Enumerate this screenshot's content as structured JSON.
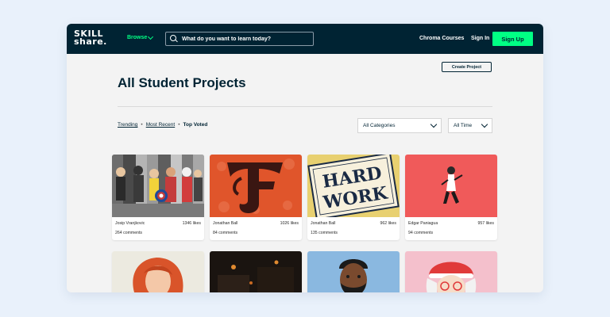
{
  "header": {
    "logo_line1": "SKILL",
    "logo_line2": "share.",
    "browse_label": "Browse",
    "search_placeholder": "What do you want to learn today?",
    "chroma_label": "Chroma Courses",
    "signin_label": "Sign In",
    "signup_label": "Sign Up"
  },
  "main": {
    "create_label": "Create Project",
    "title": "All Student Projects",
    "filters": {
      "trending": "Trending",
      "most_recent": "Most Recent",
      "top_voted": "Top Voted",
      "separator": "•"
    },
    "category_select": "All Categories",
    "time_select": "All Time"
  },
  "projects": [
    {
      "author": "Josip Vranjkovic",
      "likes": "1346 likes",
      "comments": "264 comments"
    },
    {
      "author": "Jonathan Ball",
      "likes": "1026 likes",
      "comments": "84 comments"
    },
    {
      "author": "Jonathan Ball",
      "likes": "962 likes",
      "comments": "135 comments"
    },
    {
      "author": "Edgar Paniagua",
      "likes": "957 likes",
      "comments": "94 comments"
    }
  ],
  "thumb_art": {
    "hard": "HARD",
    "work": "WORK"
  },
  "colors": {
    "navy": "#002333",
    "accent_green": "#00ff84",
    "card_red": "#f05a5a",
    "card_orange": "#e0552b"
  }
}
